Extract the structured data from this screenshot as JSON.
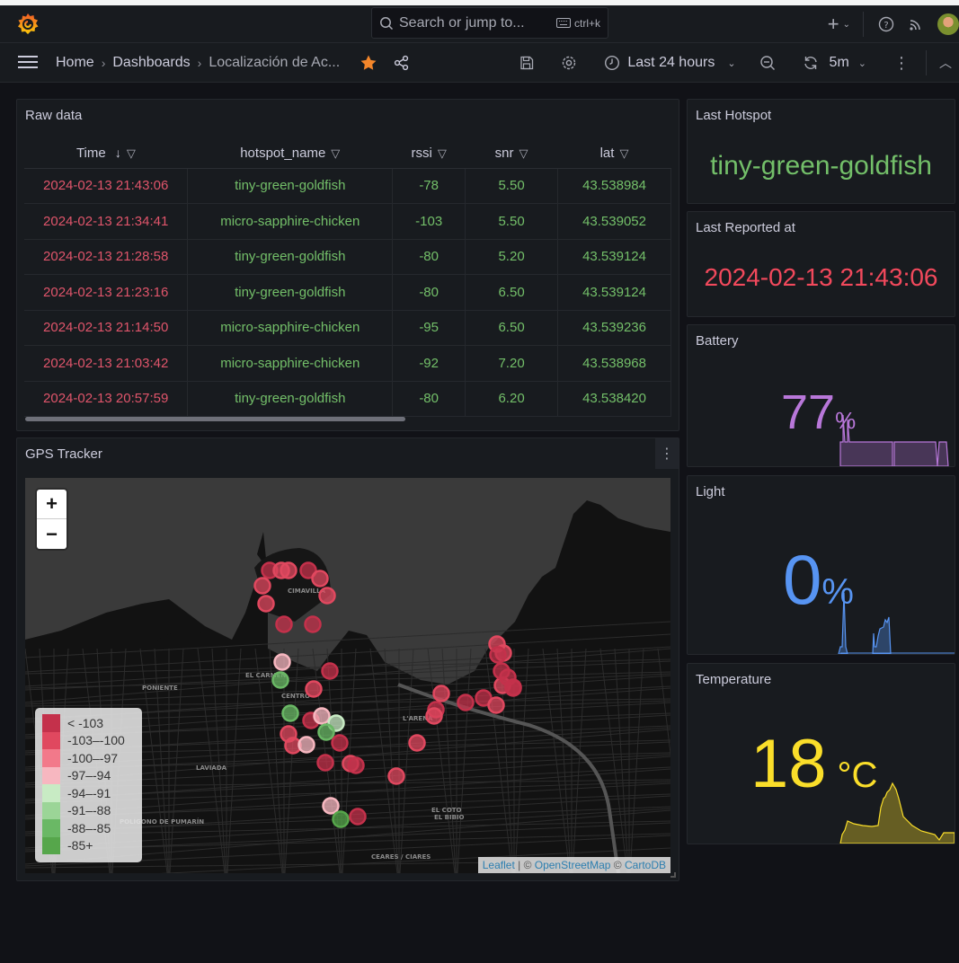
{
  "topbar": {
    "search_placeholder": "Search or jump to...",
    "search_shortcut": "ctrl+k",
    "icons": [
      "grafana-logo-icon",
      "search-icon",
      "keyboard-icon",
      "plus-icon",
      "chevron-down-icon",
      "help-icon",
      "rss-icon",
      "avatar"
    ]
  },
  "navbar": {
    "breadcrumb": [
      "Home",
      "Dashboards",
      "Localización de Ac..."
    ],
    "time_range": "Last 24 hours",
    "refresh_interval": "5m"
  },
  "raw_data": {
    "title": "Raw data",
    "columns": [
      "Time",
      "hotspot_name",
      "rssi",
      "snr",
      "lat"
    ],
    "sort_indicator": "↓",
    "rows": [
      [
        "2024-02-13 21:43:06",
        "tiny-green-goldfish",
        "-78",
        "5.50",
        "43.538984"
      ],
      [
        "2024-02-13 21:34:41",
        "micro-sapphire-chicken",
        "-103",
        "5.50",
        "43.539052"
      ],
      [
        "2024-02-13 21:28:58",
        "tiny-green-goldfish",
        "-80",
        "5.20",
        "43.539124"
      ],
      [
        "2024-02-13 21:23:16",
        "tiny-green-goldfish",
        "-80",
        "6.50",
        "43.539124"
      ],
      [
        "2024-02-13 21:14:50",
        "micro-sapphire-chicken",
        "-95",
        "6.50",
        "43.539236"
      ],
      [
        "2024-02-13 21:03:42",
        "micro-sapphire-chicken",
        "-92",
        "7.20",
        "43.538968"
      ],
      [
        "2024-02-13 20:57:59",
        "tiny-green-goldfish",
        "-80",
        "6.20",
        "43.538420"
      ]
    ]
  },
  "gps": {
    "title": "GPS Tracker",
    "zoom_in": "+",
    "zoom_out": "−",
    "legend": [
      {
        "label": "< -103",
        "color": "#c4314b"
      },
      {
        "label": "-103–-100",
        "color": "#e0485f"
      },
      {
        "label": "-100–-97",
        "color": "#f2798a"
      },
      {
        "label": "-97–-94",
        "color": "#f7b7c0"
      },
      {
        "label": "-94–-91",
        "color": "#c8ebc4"
      },
      {
        "label": "-91–-88",
        "color": "#9bd597"
      },
      {
        "label": "-88–-85",
        "color": "#6ab865"
      },
      {
        "label": "-85+",
        "color": "#56a64b"
      }
    ],
    "place_labels": [
      "CIMAVILLA",
      "EL CARMEN",
      "CENTRO",
      "PONIENTE",
      "LAVIADA",
      "L'ARENA",
      "EL BIBIO",
      "EL COTO",
      "CEARES / CIARES",
      "POLÍGONO DE PUMARÍN"
    ],
    "attribution": {
      "leaflet": "Leaflet",
      "sep": " | © ",
      "osm": "OpenStreetMap",
      "sep2": " © ",
      "carto": "CartoDB"
    }
  },
  "last_hotspot": {
    "title": "Last Hotspot",
    "value": "tiny-green-goldfish",
    "color": "#73bf69"
  },
  "last_reported": {
    "title": "Last Reported at",
    "value": "2024-02-13 21:43:06",
    "color": "#f2495c"
  },
  "battery": {
    "title": "Battery",
    "value": "77",
    "unit": "%",
    "color": "#b877d9"
  },
  "light": {
    "title": "Light",
    "value": "0",
    "unit": "%",
    "color": "#5794f2"
  },
  "temperature": {
    "title": "Temperature",
    "value": "18",
    "unit": "°C",
    "color": "#fade2a"
  }
}
